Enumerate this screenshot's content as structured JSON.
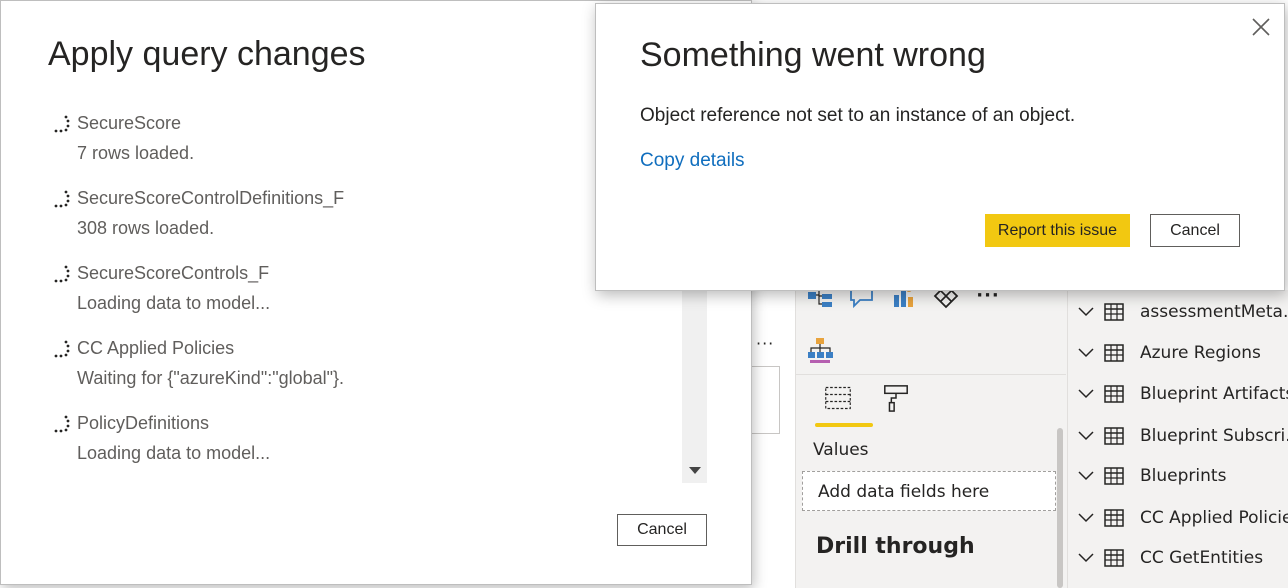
{
  "apply_dialog": {
    "title": "Apply query changes",
    "queries": [
      {
        "name": "SecureScore",
        "status": "7 rows loaded."
      },
      {
        "name": "SecureScoreControlDefinitions_F",
        "status": "308 rows loaded."
      },
      {
        "name": "SecureScoreControls_F",
        "status": "Loading data to model..."
      },
      {
        "name": "CC Applied Policies",
        "status": "Waiting for {\"azureKind\":\"global\"}."
      },
      {
        "name": "PolicyDefinitions",
        "status": "Loading data to model..."
      }
    ],
    "cancel_label": "Cancel"
  },
  "error_dialog": {
    "title": "Something went wrong",
    "message": "Object reference not set to an instance of an object.",
    "copy_details_label": "Copy details",
    "report_label": "Report this issue",
    "cancel_label": "Cancel",
    "report_color": "#f2c811",
    "link_color": "#106ebe"
  },
  "background": {
    "more_options": "···",
    "visualizations": {
      "more_visuals": "···",
      "values_label": "Values",
      "add_fields_placeholder": "Add data fields here",
      "drill_through_title": "Drill through",
      "active_tab_color": "#f2c811"
    },
    "fields": {
      "tables": [
        "assessmentMeta...",
        "Azure Regions",
        "Blueprint Artifacts",
        "Blueprint Subscri...",
        "Blueprints",
        "CC Applied Policies",
        "CC GetEntities"
      ]
    }
  }
}
